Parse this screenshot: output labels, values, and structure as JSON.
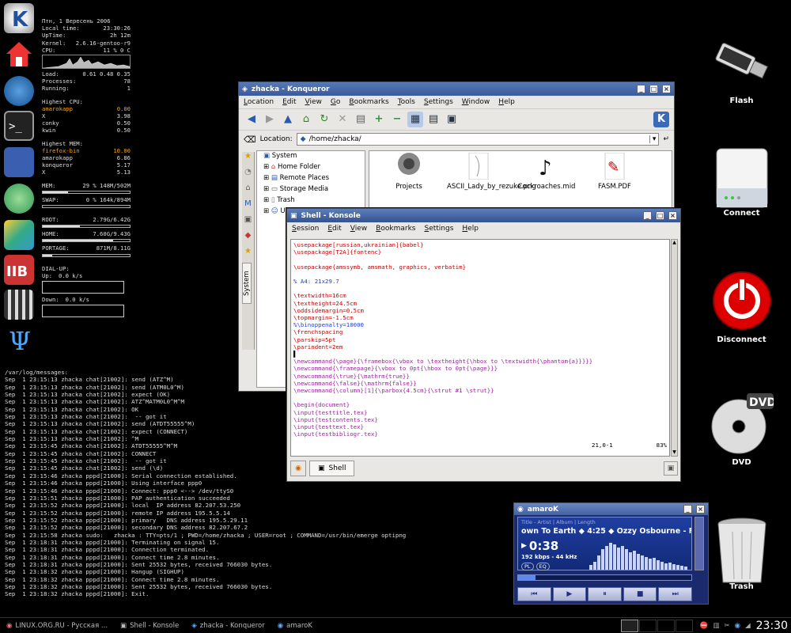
{
  "conky": {
    "date": "Птн,   1 Вересень 2006",
    "local_time_label": "Local time:",
    "local_time": "23:30:26",
    "uptime_label": "UpTime:",
    "uptime": "2h 12m",
    "kernel_label": "Kernel:",
    "kernel": "2.6.16-gentoo-r9",
    "cpu_label": "CPU:",
    "cpu": "11 % 0   C",
    "load_label": "Load:",
    "load": "0.61 0.48 0.35",
    "processes_label": "Processes:",
    "processes": "78",
    "running_label": "Running:",
    "running": "1",
    "highest_cpu_label": "Highest CPU:",
    "highest_cpu": [
      {
        "name": "amarokapp",
        "value": "0.00"
      },
      {
        "name": "X",
        "value": "3.98"
      },
      {
        "name": "conky",
        "value": "0.50"
      },
      {
        "name": "kwin",
        "value": "0.50"
      }
    ],
    "highest_mem_label": "Highest MEM:",
    "highest_mem": [
      {
        "name": "firefox-bin",
        "value": "10.00"
      },
      {
        "name": "amarokapp",
        "value": "6.86"
      },
      {
        "name": "konqueror",
        "value": "5.17"
      },
      {
        "name": "X",
        "value": "5.13"
      }
    ],
    "mem_label": "MEM:",
    "mem": "29 % 148M/502M",
    "mem_fraction": 0.29,
    "swap_label": "SWAP:",
    "swap": "0  % 164k/894M",
    "swap_fraction": 0.0,
    "root_label": "ROOT:",
    "root": "2.79G/6.42G",
    "root_fraction": 0.43,
    "home_label": "HOME:",
    "home": "7.60G/9.43G",
    "home_fraction": 0.81,
    "portage_label": "PORTAGE:",
    "portage": "871M/8.11G",
    "portage_fraction": 0.11,
    "dialup_label": "DIAL-UP:",
    "up_label": "Up:",
    "up": "0.0     k/s",
    "down_label": "Down:",
    "down": "0.0     k/s"
  },
  "log": {
    "title": "/var/log/messages:",
    "lines": [
      "Sep  1 23:15:13 zhacka chat[21002]: send (ATZ^M)",
      "Sep  1 23:15:13 zhacka chat[21002]: send (ATM0L0^M)",
      "Sep  1 23:15:13 zhacka chat[21002]: expect (OK)",
      "Sep  1 23:15:13 zhacka chat[21002]: ATZ^MATM0L0^M^M",
      "Sep  1 23:15:13 zhacka chat[21002]: OK",
      "Sep  1 23:15:13 zhacka chat[21002]:  -- got it",
      "Sep  1 23:15:13 zhacka chat[21002]: send (ATDT55555^M)",
      "Sep  1 23:15:13 zhacka chat[21002]: expect (CONNECT)",
      "Sep  1 23:15:13 zhacka chat[21002]: ^M",
      "Sep  1 23:15:45 zhacka chat[21002]: ATDT55555^M^M",
      "Sep  1 23:15:45 zhacka chat[21002]: CONNECT",
      "Sep  1 23:15:45 zhacka chat[21002]:  -- got it",
      "Sep  1 23:15:45 zhacka chat[21002]: send (\\d)",
      "Sep  1 23:15:46 zhacka pppd[21000]: Serial connection established.",
      "Sep  1 23:15:46 zhacka pppd[21000]: Using interface ppp0",
      "Sep  1 23:15:46 zhacka pppd[21000]: Connect: ppp0 <--> /dev/ttyS0",
      "Sep  1 23:15:51 zhacka pppd[21000]: PAP authentication succeeded",
      "Sep  1 23:15:52 zhacka pppd[21000]: local  IP address 82.207.53.250",
      "Sep  1 23:15:52 zhacka pppd[21000]: remote IP address 195.5.5.14",
      "Sep  1 23:15:52 zhacka pppd[21000]: primary   DNS address 195.5.29.11",
      "Sep  1 23:15:52 zhacka pppd[21000]: secondary DNS address 82.207.67.2",
      "Sep  1 23:15:58 zhacka sudo:   zhacka : TTY=pts/1 ; PWD=/home/zhacka ; USER=root ; COMMAND=/usr/bin/emerge optipng",
      "Sep  1 23:18:31 zhacka pppd[21000]: Terminating on signal 15.",
      "Sep  1 23:18:31 zhacka pppd[21000]: Connection terminated.",
      "Sep  1 23:18:31 zhacka pppd[21000]: Connect time 2.8 minutes.",
      "Sep  1 23:18:31 zhacka pppd[21000]: Sent 25532 bytes, received 766030 bytes.",
      "Sep  1 23:18:32 zhacka pppd[21000]: Hangup (SIGHUP)",
      "Sep  1 23:18:32 zhacka pppd[21000]: Connect time 2.8 minutes.",
      "Sep  1 23:18:32 zhacka pppd[21000]: Sent 25532 bytes, received 766030 bytes.",
      "Sep  1 23:18:32 zhacka pppd[21000]: Exit."
    ]
  },
  "desktop_icons": {
    "flash": "Flash",
    "connect": "Connect",
    "disconnect": "Disconnect",
    "dvd": "DVD",
    "trash": "Trash"
  },
  "konqueror": {
    "title": "zhacka - Konqueror",
    "menu": [
      "Location",
      "Edit",
      "View",
      "Go",
      "Bookmarks",
      "Tools",
      "Settings",
      "Window",
      "Help"
    ],
    "location_label": "Location:",
    "location_value": "/home/zhacka/",
    "tree": [
      "System",
      "Home Folder",
      "Remote Places",
      "Storage Media",
      "Trash",
      "Us"
    ],
    "sidebar_tab": "System",
    "files": [
      {
        "name": "Projects",
        "icon": "folder-icon"
      },
      {
        "name": "ASCII_Lady_by_rezuke.png",
        "icon": "image-icon"
      },
      {
        "name": "Cockroaches.mid",
        "icon": "music-note-icon"
      },
      {
        "name": "FASM.PDF",
        "icon": "pdf-icon"
      }
    ]
  },
  "konsole": {
    "title": "Shell - Konsole",
    "menu": [
      "Session",
      "Edit",
      "View",
      "Bookmarks",
      "Settings",
      "Help"
    ],
    "lines": [
      {
        "t": "\\usepackage[russian,ukrainian]{babel}",
        "c": "red"
      },
      {
        "t": "\\usepackage[T2A]{fontenc}",
        "c": "red"
      },
      {
        "t": "",
        "c": "blk"
      },
      {
        "t": "\\usepackage{amssymb, amsmath, graphics, verbatim}",
        "c": "red"
      },
      {
        "t": "",
        "c": "blk"
      },
      {
        "t": "% A4: 21x29.7",
        "c": "blu"
      },
      {
        "t": "",
        "c": "blk"
      },
      {
        "t": "\\textwidth=16cm",
        "c": "red"
      },
      {
        "t": "\\textheight=24.5cm",
        "c": "red"
      },
      {
        "t": "\\oddsidemargin=0.5cm",
        "c": "red"
      },
      {
        "t": "\\topmargin=-1.5cm",
        "c": "red"
      },
      {
        "t": "%\\binoppenalty=10000",
        "c": "blu"
      },
      {
        "t": "\\frenchspacing",
        "c": "red"
      },
      {
        "t": "\\parskip=5pt",
        "c": "red"
      },
      {
        "t": "\\parindent=2em",
        "c": "red"
      },
      {
        "t": "▌",
        "c": "blk"
      },
      {
        "t": "\\newcommand{\\page}{\\framebox{\\vbox to \\textheight{\\hbox to \\textwidth{\\phantom{a}}}}}",
        "c": "pur"
      },
      {
        "t": "\\newcommand{\\framepage}{\\vbox to 0pt{\\hbox to 0pt{\\page}}}",
        "c": "pur"
      },
      {
        "t": "\\newcommand{\\true}{\\mathrm{true}}",
        "c": "pur"
      },
      {
        "t": "\\newcommand{\\false}{\\mathrm{false}}",
        "c": "pur"
      },
      {
        "t": "\\newcommand{\\column}[1]{\\parbox{4.5cm}{\\strut #1 \\strut}}",
        "c": "pur"
      },
      {
        "t": "",
        "c": "blk"
      },
      {
        "t": "\\begin{document}",
        "c": "pur"
      },
      {
        "t": "\\input{testtitle.tex}",
        "c": "pur"
      },
      {
        "t": "\\input{testcontents.tex}",
        "c": "pur"
      },
      {
        "t": "\\input{testtext.tex}",
        "c": "pur"
      },
      {
        "t": "\\input{testbibliogr.tex}",
        "c": "pur"
      }
    ],
    "cursor_pos": "21,0-1",
    "percent": "83%",
    "tab_label": "Shell"
  },
  "amarok": {
    "title": "amaroK",
    "header": "Title - Artist | Album | Length",
    "scroll": "own To Earth  ◆  4:25  ◆  Ozzy Osbourne - Fa",
    "time": "0:38",
    "bitrate": "192 kbps - 44 kHz",
    "pl": "PL",
    "eq": "EQ",
    "progress": 0.1
  },
  "taskbar": {
    "tasks": [
      "LINUX.ORG.RU - Русская ...",
      "Shell - Konsole",
      "zhacka - Konqueror",
      "amaroK"
    ],
    "clock": "23:30"
  }
}
